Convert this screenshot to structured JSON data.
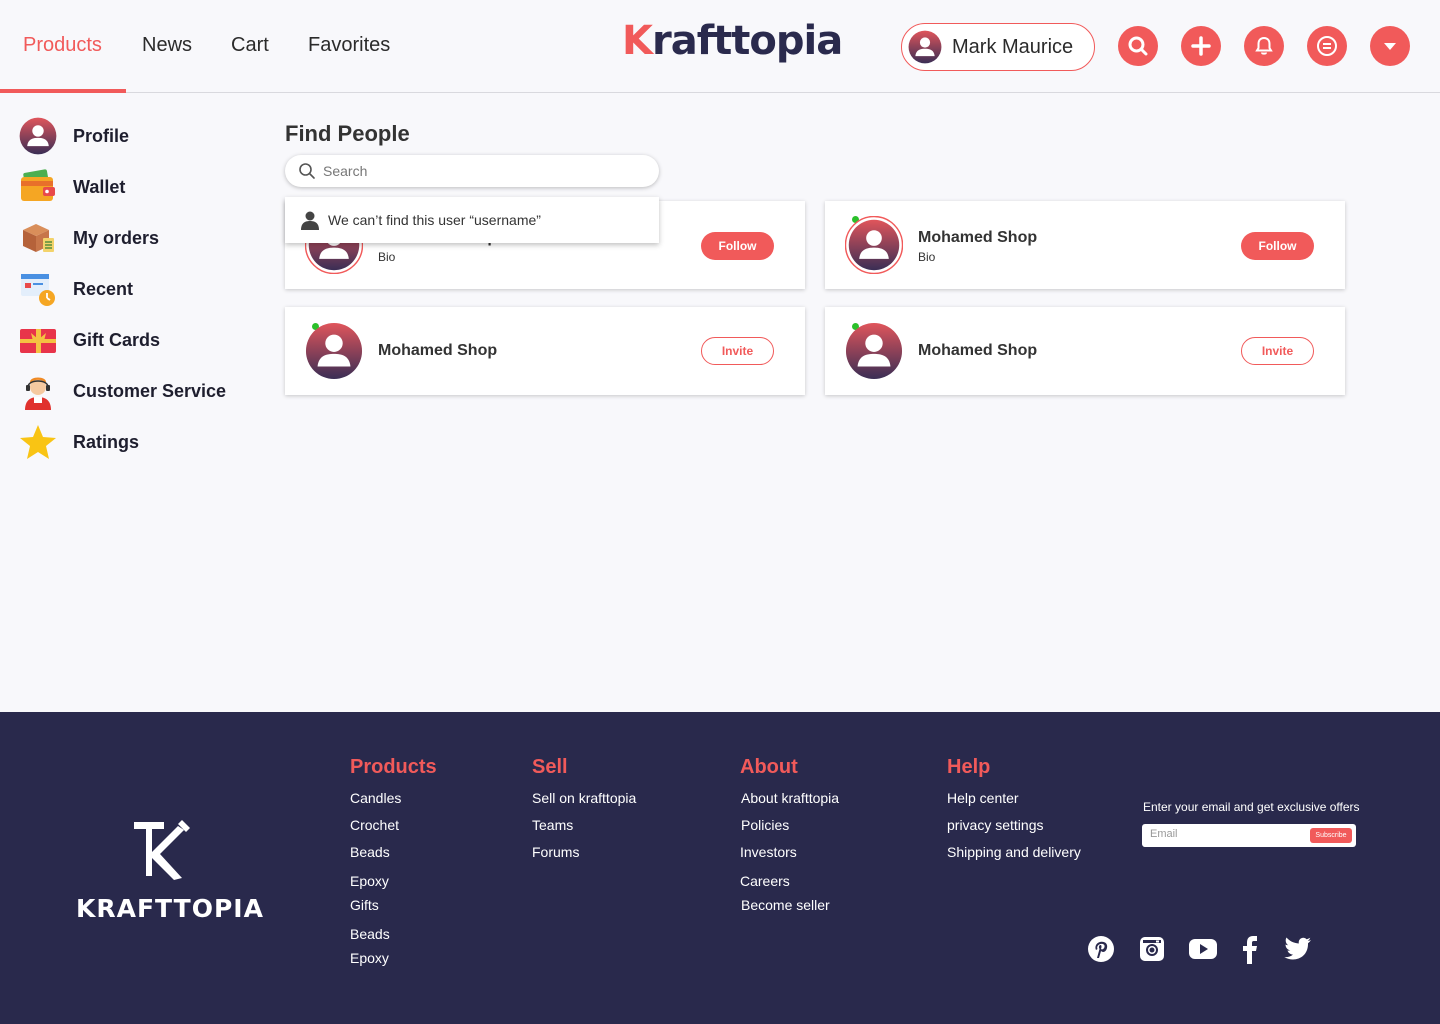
{
  "nav": {
    "items": [
      {
        "label": "Products",
        "active": true
      },
      {
        "label": "News",
        "active": false
      },
      {
        "label": "Cart",
        "active": false
      },
      {
        "label": "Favorites",
        "active": false
      }
    ]
  },
  "brand": {
    "logo_first": "K",
    "logo_rest": "rafttopia",
    "accent": "#f15a5a",
    "dark": "#29294c"
  },
  "user": {
    "name": "Mark Maurice"
  },
  "header_icons": [
    "search-icon",
    "plus-icon",
    "bell-icon",
    "chat-icon",
    "chevron-down-icon"
  ],
  "sidebar": {
    "items": [
      {
        "label": "Profile",
        "icon": "profile-icon"
      },
      {
        "label": "Wallet",
        "icon": "wallet-icon"
      },
      {
        "label": "My orders",
        "icon": "box-icon"
      },
      {
        "label": "Recent",
        "icon": "recent-icon"
      },
      {
        "label": "Gift Cards",
        "icon": "gift-card-icon"
      },
      {
        "label": "Customer Service",
        "icon": "support-agent-icon"
      },
      {
        "label": "Ratings",
        "icon": "star-icon"
      }
    ]
  },
  "main": {
    "title": "Find People",
    "search": {
      "placeholder": "Search",
      "value": ""
    },
    "dropdown_message": "We can’t find this user “username”",
    "cards": [
      {
        "name": "Mohamed Shop",
        "bio": "Bio",
        "action": "Follow"
      },
      {
        "name": "Mohamed Shop",
        "bio": "Bio",
        "action": "Follow"
      },
      {
        "name": "Mohamed Shop",
        "bio": "",
        "action": "Invite"
      },
      {
        "name": "Mohamed Shop",
        "bio": "",
        "action": "Invite"
      }
    ]
  },
  "footer": {
    "brand": "KRAFTTOPIA",
    "columns": [
      {
        "title": "Products",
        "links": [
          "Candles",
          "Crochet",
          "Beads",
          "Epoxy",
          "Gifts",
          "Beads",
          "Epoxy"
        ]
      },
      {
        "title": "Sell",
        "links": [
          "Sell on krafttopia",
          "Teams",
          "Forums"
        ]
      },
      {
        "title": "About",
        "links": [
          "About krafttopia",
          "Policies",
          "Investors",
          "Careers",
          "Become seller"
        ]
      },
      {
        "title": "Help",
        "links": [
          "Help center",
          "privacy settings",
          "Shipping and delivery"
        ]
      }
    ],
    "newsletter": {
      "text": "Enter your email and get exclusive offers",
      "placeholder": "Email",
      "button": "Subscribe"
    },
    "social": [
      "pinterest-icon",
      "instagram-icon",
      "youtube-icon",
      "facebook-icon",
      "twitter-icon"
    ]
  }
}
